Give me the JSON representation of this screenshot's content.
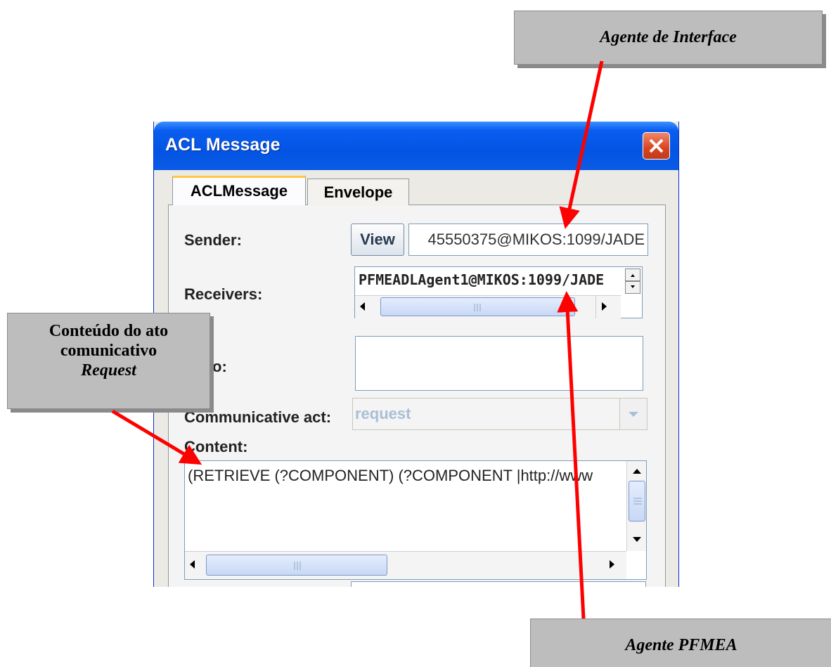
{
  "annotations": {
    "interface_agent": "Agente de Interface",
    "pfmea_agent": "Agente PFMEA",
    "content_line1": "Conteúdo do ato",
    "content_line2": "comunicativo",
    "content_line3": "Request"
  },
  "window": {
    "title": "ACL Message",
    "tabs": [
      {
        "label": "ACLMessage",
        "selected": true
      },
      {
        "label": "Envelope",
        "selected": false
      }
    ]
  },
  "form": {
    "sender_label": "Sender:",
    "view_button": "View",
    "sender_value": "45550375@MIKOS:1099/JADE",
    "receivers_label": "Receivers:",
    "receivers_value": "PFMEADLAgent1@MIKOS:1099/JADE",
    "reply_label": "Reply-to:",
    "reply_label_visible": "ly-to:",
    "act_label": "Communicative act:",
    "act_label_visible": "Communicative act:",
    "act_value": "request",
    "content_label": "Content:",
    "content_value": "(RETRIEVE (?COMPONENT) (?COMPONENT |http://www"
  },
  "colors": {
    "arrow": "#ff0000",
    "title_bar": "#0354e3",
    "callout": "#bdbdbd"
  }
}
